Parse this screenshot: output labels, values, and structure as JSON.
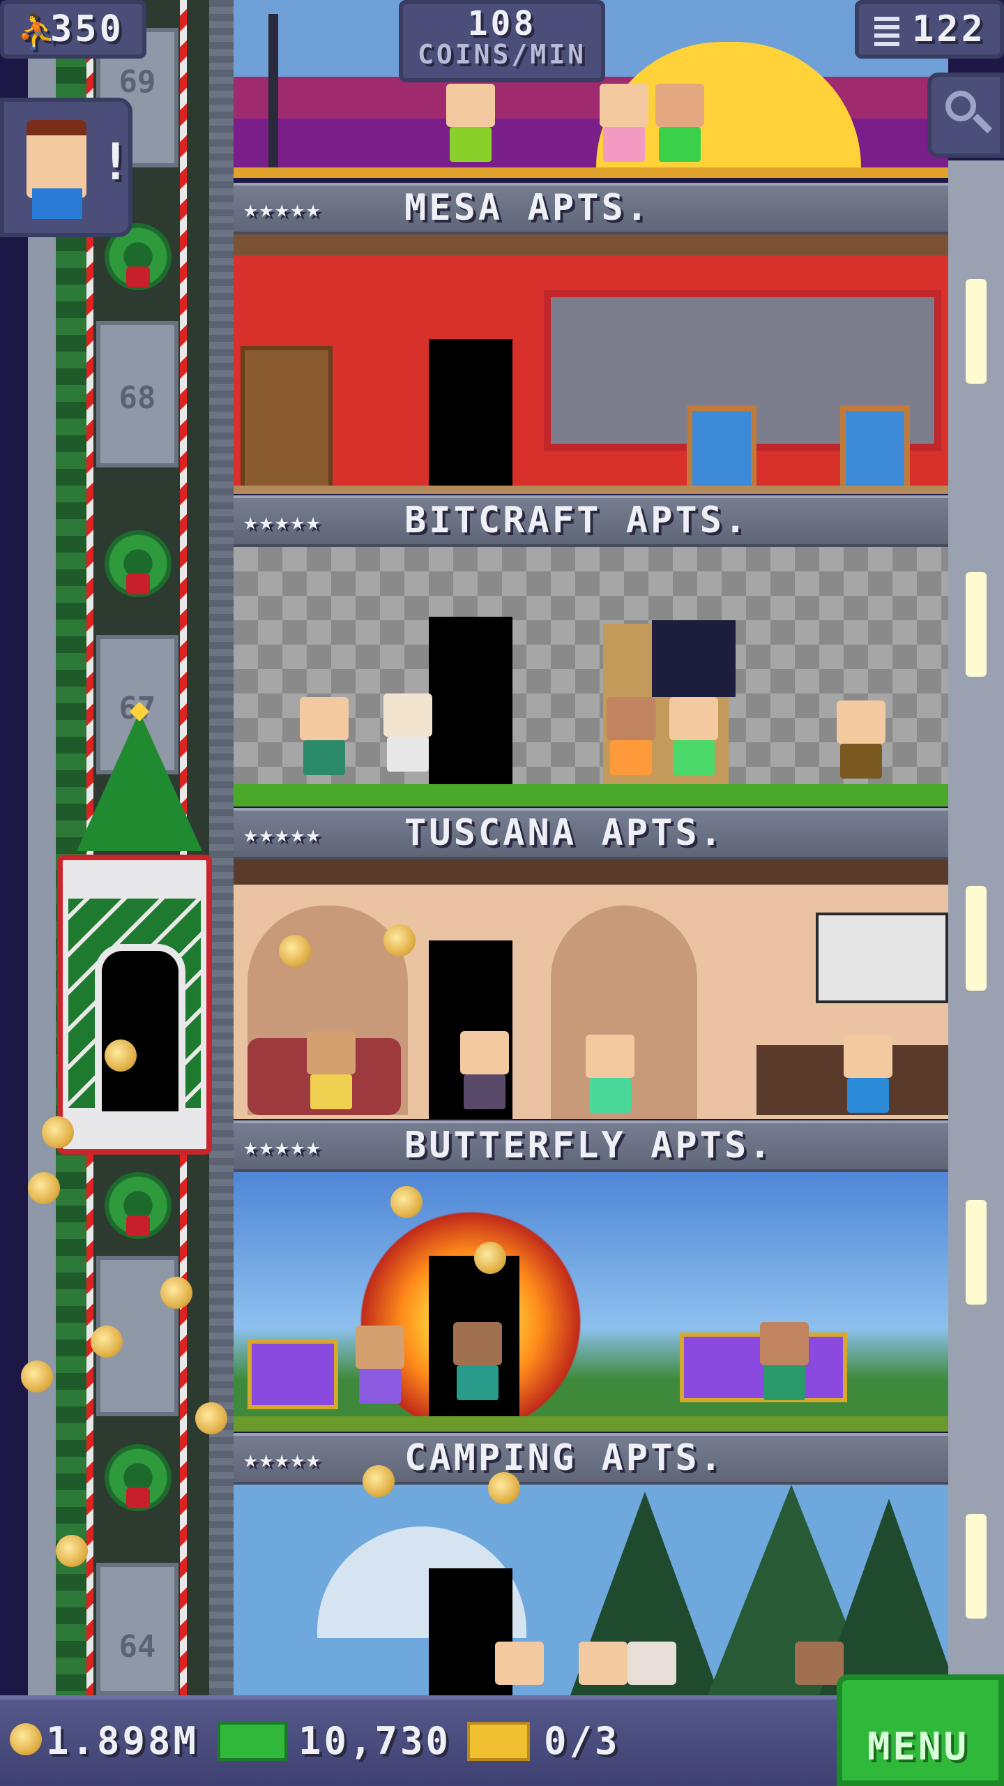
{
  "hud": {
    "population": "350",
    "coins_per_min_value": "108",
    "coins_per_min_label": "COINS/MIN",
    "tower_floors": "122"
  },
  "elevator": {
    "floor_numbers": [
      "69",
      "68",
      "67",
      "64"
    ]
  },
  "floors": [
    {
      "name": "MESA APTS.",
      "stars": "★★★★★"
    },
    {
      "name": "BITCRAFT APTS.",
      "stars": "★★★★★"
    },
    {
      "name": "TUSCANA APTS.",
      "stars": "★★★★★"
    },
    {
      "name": "BUTTERFLY APTS.",
      "stars": "★★★★★"
    },
    {
      "name": "CAMPING APTS.",
      "stars": "★★★★★"
    }
  ],
  "bottom_bar": {
    "coins": "1.898M",
    "bux": "10,730",
    "tickets": "0/3",
    "menu_label": "MENU"
  },
  "icons": {
    "population": "person-icon",
    "floors": "building-icon",
    "search": "magnifier-icon",
    "notification": "exclamation-icon",
    "coins": "coin-icon",
    "bux": "cash-icon",
    "tickets": "ticket-icon"
  },
  "colors": {
    "hud_panel": "#4a4e78",
    "menu_green": "#2fb83a",
    "mesa_wall": "#d8302a",
    "tuscana_wall": "#e9c3a2",
    "butterfly_sky": "#4f86d6",
    "camping_sky": "#6fa8dc"
  }
}
